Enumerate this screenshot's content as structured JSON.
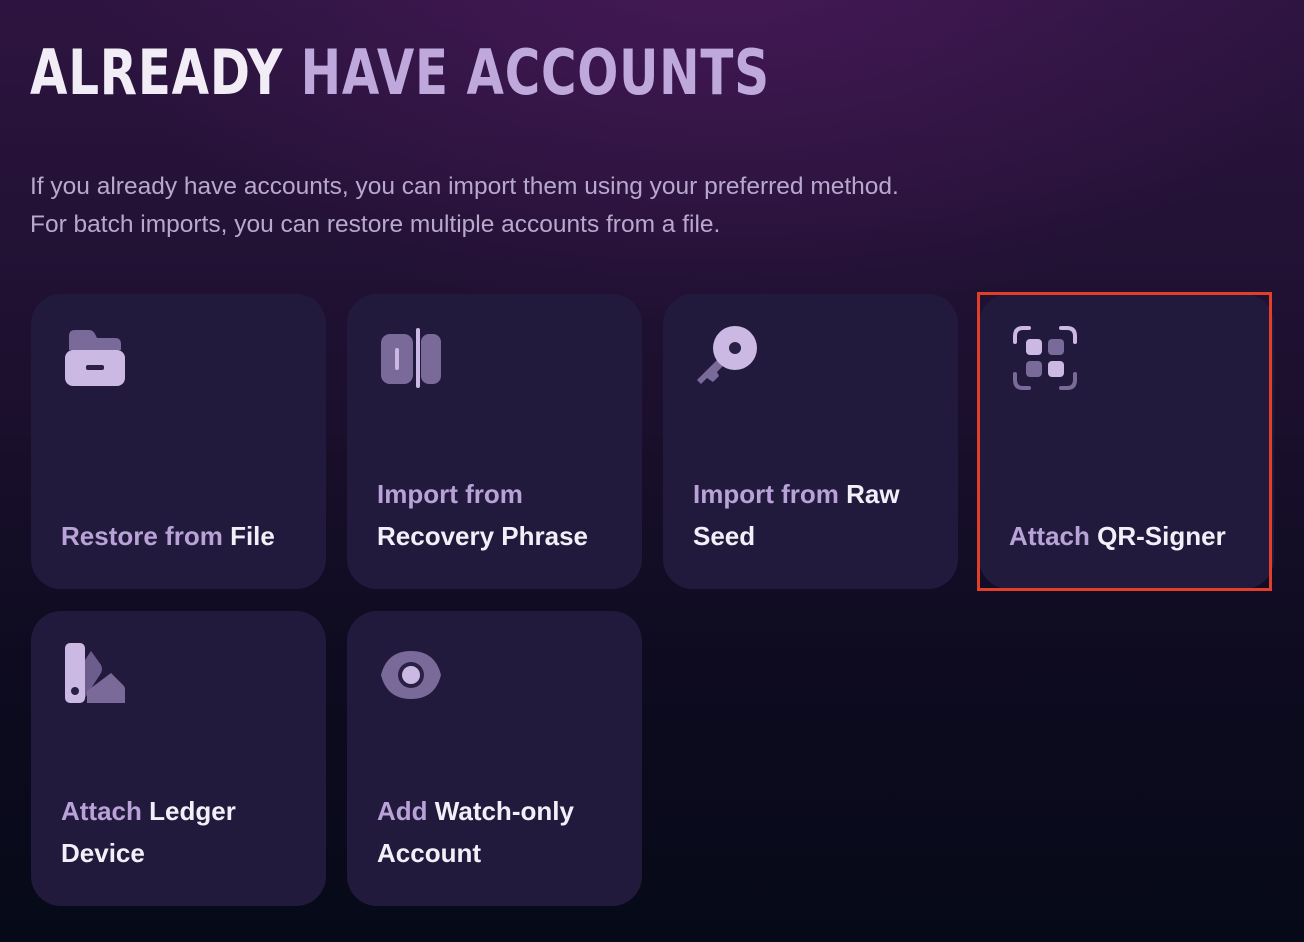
{
  "header": {
    "title_word1": "ALREADY",
    "title_word2": "HAVE ACCOUNTS",
    "description": "If you already have accounts, you can import them using your preferred method. For batch imports, you can restore multiple accounts from a file."
  },
  "options": [
    {
      "prefix": "Restore from",
      "suffix": "File",
      "icon": "folder-icon"
    },
    {
      "prefix": "Import from",
      "suffix": "Recovery Phrase",
      "icon": "recovery-phrase-icon"
    },
    {
      "prefix": "Import from",
      "suffix": "Raw Seed",
      "icon": "key-icon"
    },
    {
      "prefix": "Attach",
      "suffix": "QR-Signer",
      "icon": "qr-scan-icon",
      "highlighted": true
    },
    {
      "prefix": "Attach",
      "suffix": "Ledger Device",
      "icon": "ledger-icon"
    },
    {
      "prefix": "Add",
      "suffix": "Watch-only Account",
      "icon": "eye-icon"
    }
  ],
  "colors": {
    "accent_light": "#c8b6e2",
    "accent_dark": "#7a6a9a",
    "card_bg": "#221a3c",
    "highlight": "#e0402a"
  }
}
